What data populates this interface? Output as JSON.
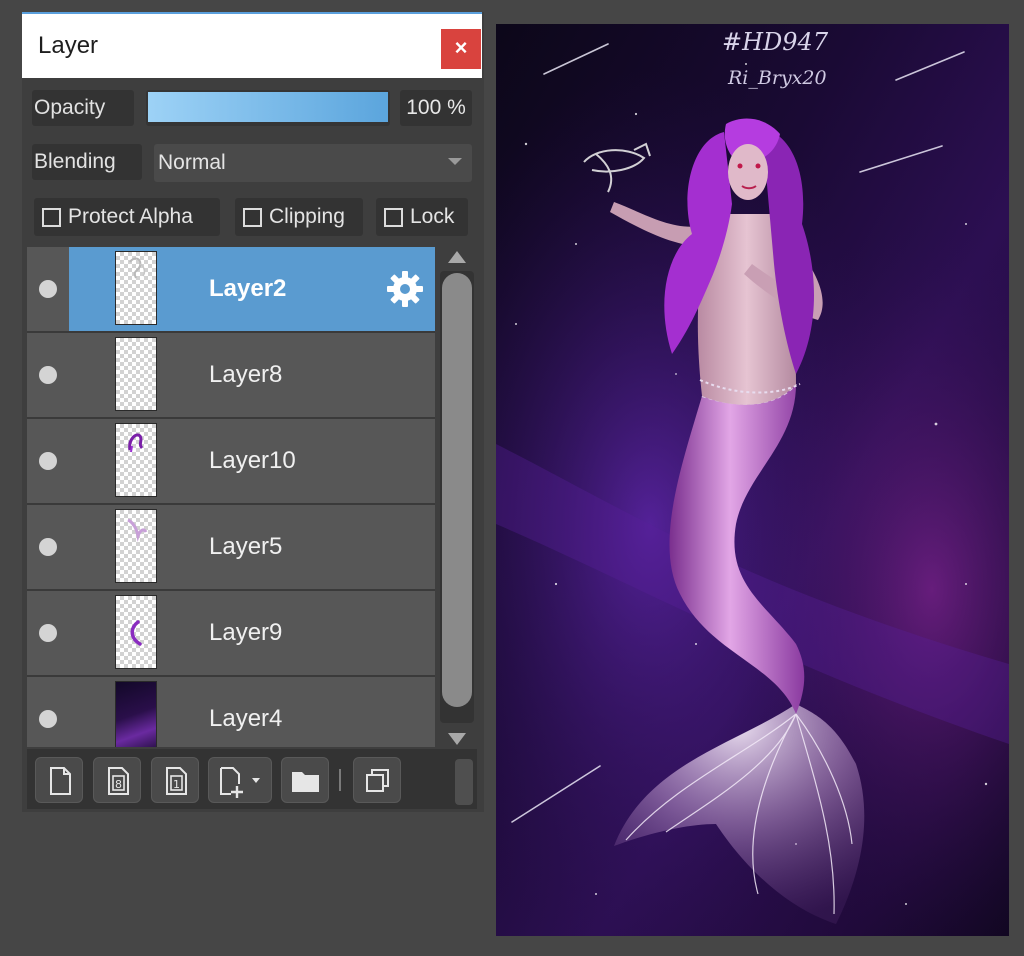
{
  "panel": {
    "title": "Layer",
    "close_label": "×",
    "opacity": {
      "label": "Opacity",
      "value": 100,
      "value_text": "100 %"
    },
    "blending": {
      "label": "Blending",
      "selected": "Normal"
    },
    "checkboxes": [
      {
        "label": "Protect Alpha",
        "checked": false
      },
      {
        "label": "Clipping",
        "checked": false
      },
      {
        "label": "Lock",
        "checked": false
      }
    ],
    "layers": [
      {
        "name": "Layer2",
        "selected": true,
        "visible": true,
        "thumb": "sketch"
      },
      {
        "name": "Layer8",
        "selected": false,
        "visible": true,
        "thumb": "empty"
      },
      {
        "name": "Layer10",
        "selected": false,
        "visible": true,
        "thumb": "purple-hair"
      },
      {
        "name": "Layer5",
        "selected": false,
        "visible": true,
        "thumb": "lilac-shape"
      },
      {
        "name": "Layer9",
        "selected": false,
        "visible": true,
        "thumb": "purple-curve"
      },
      {
        "name": "Layer4",
        "selected": false,
        "visible": true,
        "thumb": "space"
      }
    ],
    "toolbar_icons": [
      "new-layer-icon",
      "new-8bit-layer-icon",
      "new-1bit-layer-icon",
      "add-layer-dropdown-icon",
      "folder-icon",
      "duplicate-layer-icon"
    ]
  },
  "canvas": {
    "signature_line1": "#HD947",
    "signature_line2": "Ri_Bryx20"
  },
  "colors": {
    "accent": "#5a9bd0",
    "close": "#d9433e",
    "panel_bg": "#3e3e3e",
    "app_bg": "#464646"
  }
}
